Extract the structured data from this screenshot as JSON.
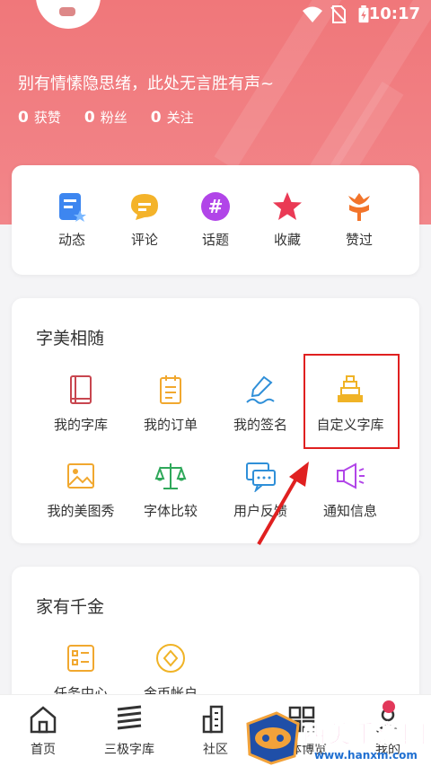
{
  "status_bar": {
    "time": "10:17",
    "icons": [
      "wifi-icon",
      "no-sim-icon",
      "battery-charging-icon"
    ]
  },
  "profile": {
    "bio": "别有情愫隐思绪，此处无言胜有声~",
    "stats": [
      {
        "count": "0",
        "label": "获赞"
      },
      {
        "count": "0",
        "label": "粉丝"
      },
      {
        "count": "0",
        "label": "关注"
      }
    ]
  },
  "quick_actions": [
    {
      "label": "动态",
      "icon": "dynamic-icon"
    },
    {
      "label": "评论",
      "icon": "comment-icon"
    },
    {
      "label": "话题",
      "icon": "topic-hash-icon"
    },
    {
      "label": "收藏",
      "icon": "star-icon"
    },
    {
      "label": "赞过",
      "icon": "tulip-icon"
    }
  ],
  "font_section": {
    "title": "字美相随",
    "items": [
      {
        "label": "我的字库",
        "icon": "book-icon"
      },
      {
        "label": "我的订单",
        "icon": "order-icon"
      },
      {
        "label": "我的签名",
        "icon": "signature-pen-icon"
      },
      {
        "label": "自定义字库",
        "icon": "pyramid-icon"
      },
      {
        "label": "我的美图秀",
        "icon": "image-icon"
      },
      {
        "label": "字体比较",
        "icon": "scale-icon"
      },
      {
        "label": "用户反馈",
        "icon": "feedback-chat-icon"
      },
      {
        "label": "通知信息",
        "icon": "megaphone-icon"
      }
    ]
  },
  "gold_section": {
    "title": "家有千金",
    "items": [
      {
        "label": "任务中心",
        "icon": "task-list-icon"
      },
      {
        "label": "金币帐户",
        "icon": "coin-icon"
      }
    ]
  },
  "bottom_nav": [
    {
      "label": "首页",
      "icon": "home-icon"
    },
    {
      "label": "三极字库",
      "icon": "font-library-icon"
    },
    {
      "label": "社区",
      "icon": "community-building-icon"
    },
    {
      "label": "字体博览",
      "icon": "grid-icon"
    },
    {
      "label": "我的",
      "icon": "profile-icon"
    }
  ],
  "watermark": {
    "text": "西美手游网",
    "url": "www.hanxm.com"
  },
  "colors": {
    "header": "#f0777a",
    "highlight": "#e02020",
    "accent_red": "#e2385a"
  }
}
